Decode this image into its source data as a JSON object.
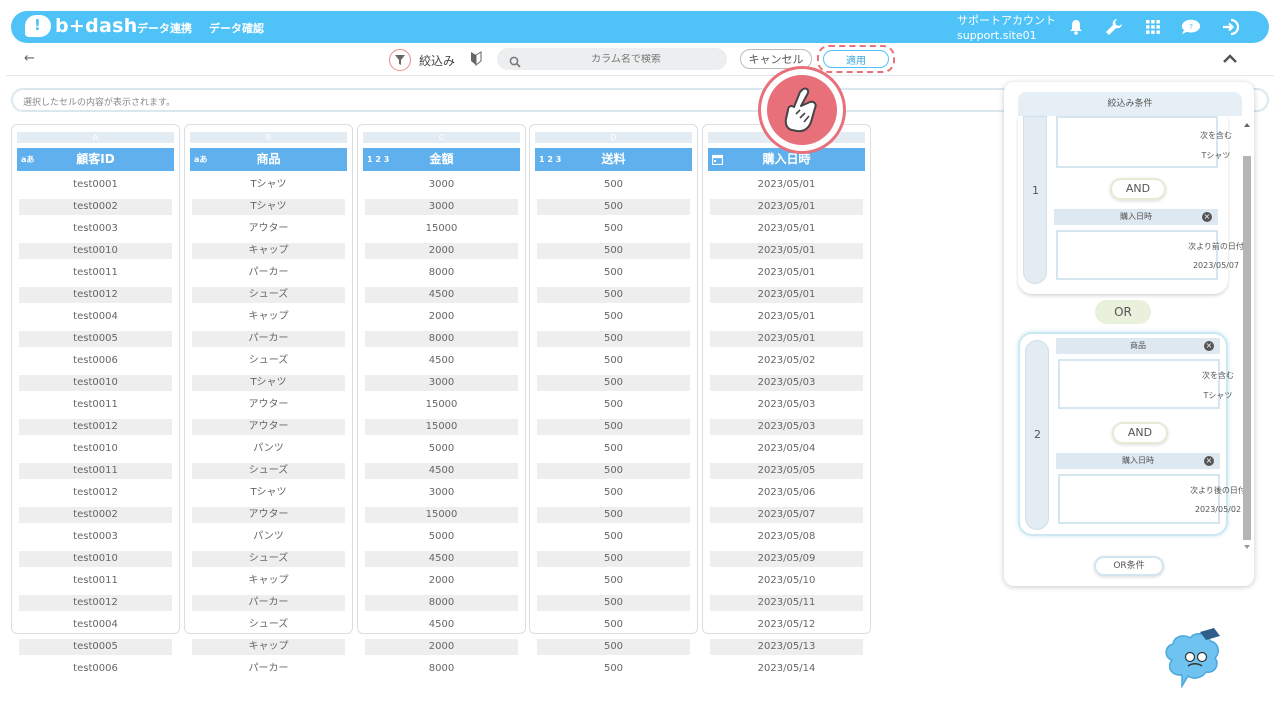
{
  "header": {
    "logo_text": "b+dash",
    "nav": [
      "データ連携",
      "データ確認"
    ],
    "account_name": "サポートアカウント",
    "account_id": "support.site01",
    "icons": [
      "bell-icon",
      "wrench-icon",
      "grid-icon",
      "chat-icon",
      "logout-icon"
    ]
  },
  "toolbar": {
    "back_glyph": "←",
    "filter_label": "絞込み",
    "search_placeholder": "カラム名で検索",
    "cancel_label": "キャンセル",
    "apply_label": "適用"
  },
  "cell_info": {
    "placeholder": "選択したセルの内容が表示されます。"
  },
  "table": {
    "columns": [
      {
        "letter": "A",
        "type": "aあ",
        "name": "顧客ID"
      },
      {
        "letter": "B",
        "type": "aあ",
        "name": "商品"
      },
      {
        "letter": "C",
        "type": "1 2 3",
        "name": "金額"
      },
      {
        "letter": "D",
        "type": "1 2 3",
        "name": "送料"
      },
      {
        "letter": "E",
        "type": "calendar-icon",
        "name": "購入日時"
      }
    ],
    "rows": [
      [
        "test0001",
        "Tシャツ",
        "3000",
        "500",
        "2023/05/01"
      ],
      [
        "test0002",
        "Tシャツ",
        "3000",
        "500",
        "2023/05/01"
      ],
      [
        "test0003",
        "アウター",
        "15000",
        "500",
        "2023/05/01"
      ],
      [
        "test0010",
        "キャップ",
        "2000",
        "500",
        "2023/05/01"
      ],
      [
        "test0011",
        "パーカー",
        "8000",
        "500",
        "2023/05/01"
      ],
      [
        "test0012",
        "シューズ",
        "4500",
        "500",
        "2023/05/01"
      ],
      [
        "test0004",
        "キャップ",
        "2000",
        "500",
        "2023/05/01"
      ],
      [
        "test0005",
        "パーカー",
        "8000",
        "500",
        "2023/05/01"
      ],
      [
        "test0006",
        "シューズ",
        "4500",
        "500",
        "2023/05/02"
      ],
      [
        "test0010",
        "Tシャツ",
        "3000",
        "500",
        "2023/05/03"
      ],
      [
        "test0011",
        "アウター",
        "15000",
        "500",
        "2023/05/03"
      ],
      [
        "test0012",
        "アウター",
        "15000",
        "500",
        "2023/05/03"
      ],
      [
        "test0010",
        "パンツ",
        "5000",
        "500",
        "2023/05/04"
      ],
      [
        "test0011",
        "シューズ",
        "4500",
        "500",
        "2023/05/05"
      ],
      [
        "test0012",
        "Tシャツ",
        "3000",
        "500",
        "2023/05/06"
      ],
      [
        "test0002",
        "アウター",
        "15000",
        "500",
        "2023/05/07"
      ],
      [
        "test0003",
        "パンツ",
        "5000",
        "500",
        "2023/05/08"
      ],
      [
        "test0010",
        "シューズ",
        "4500",
        "500",
        "2023/05/09"
      ],
      [
        "test0011",
        "キャップ",
        "2000",
        "500",
        "2023/05/10"
      ],
      [
        "test0012",
        "パーカー",
        "8000",
        "500",
        "2023/05/11"
      ],
      [
        "test0004",
        "シューズ",
        "4500",
        "500",
        "2023/05/12"
      ],
      [
        "test0005",
        "キャップ",
        "2000",
        "500",
        "2023/05/13"
      ],
      [
        "test0006",
        "パーカー",
        "8000",
        "500",
        "2023/05/14"
      ]
    ]
  },
  "panel": {
    "title": "絞込み条件",
    "group1": {
      "number": "1",
      "cond1_line1": "次を含む",
      "cond1_line2": "Tシャツ",
      "and_label": "AND",
      "cond2_column": "購入日時",
      "cond2_line1": "次より前の日付",
      "cond2_line2": "2023/05/07"
    },
    "or_label": "OR",
    "group2": {
      "number": "2",
      "cond1_column": "商品",
      "cond1_line1": "次を含む",
      "cond1_line2": "Tシャツ",
      "and_label": "AND",
      "cond2_column": "購入日時",
      "cond2_line1": "次より後の日付",
      "cond2_line2": "2023/05/02"
    },
    "or_condition_label": "OR条件"
  },
  "colors": {
    "header": "#4fc3f7",
    "column_header": "#5fb0ec",
    "accent_red": "#e8707a"
  }
}
